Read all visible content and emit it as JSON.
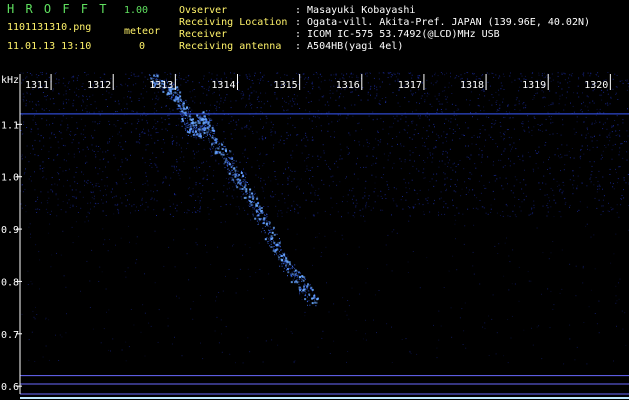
{
  "header": {
    "app_title": "H R O F F T",
    "version": "1.00",
    "filename": "1101131310.png",
    "meteor_label": "meteor",
    "datetime": "11.01.13 13:10",
    "meteor_count": "0",
    "info_labels": [
      "Ovserver",
      "Receiving Location",
      "Receiver",
      "Receiving antenna"
    ],
    "info_values": [
      ": Masayuki Kobayashi",
      ": Ogata-vill. Akita-Pref. JAPAN (139.96E, 40.02N)",
      ": ICOM IC-575 53.7492(@LCD)MHz USB",
      ": A504HB(yagi 4el)"
    ]
  },
  "colors": {
    "background": "#000000",
    "noise": "#1a2a9a",
    "echo": "#6aa8ff",
    "grid_line": "#6a6aff",
    "header_green": "#5fe05f",
    "header_yellow": "#fff36a"
  },
  "chart_data": {
    "type": "heatmap",
    "ylabel": "kHz",
    "x_ticks": [
      "1311",
      "1312",
      "1313",
      "1314",
      "1315",
      "1316",
      "1317",
      "1318",
      "1319",
      "1320"
    ],
    "y_ticks": [
      "1.1",
      "1.0",
      "0.9",
      "0.8",
      "0.7",
      "0.6"
    ],
    "x_range": [
      1310.5,
      1320.3
    ],
    "y_range": [
      0.585,
      1.2
    ],
    "noise_band_upper_ylim": [
      1.0,
      1.2
    ],
    "carrier_line_y": 1.12,
    "reference_lines_y": [
      0.62,
      0.604,
      0.585
    ],
    "echo_trace": [
      {
        "x": 1312.6,
        "y": 1.19
      },
      {
        "x": 1312.9,
        "y": 1.17
      },
      {
        "x": 1313.1,
        "y": 1.14
      },
      {
        "x": 1313.2,
        "y": 1.1
      },
      {
        "x": 1313.35,
        "y": 1.08
      },
      {
        "x": 1313.45,
        "y": 1.12
      },
      {
        "x": 1313.55,
        "y": 1.08
      },
      {
        "x": 1313.8,
        "y": 1.04
      },
      {
        "x": 1314.0,
        "y": 1.0
      },
      {
        "x": 1314.2,
        "y": 0.96
      },
      {
        "x": 1314.4,
        "y": 0.92
      },
      {
        "x": 1314.6,
        "y": 0.87
      },
      {
        "x": 1314.8,
        "y": 0.83
      },
      {
        "x": 1315.0,
        "y": 0.8
      },
      {
        "x": 1315.2,
        "y": 0.76
      }
    ]
  }
}
